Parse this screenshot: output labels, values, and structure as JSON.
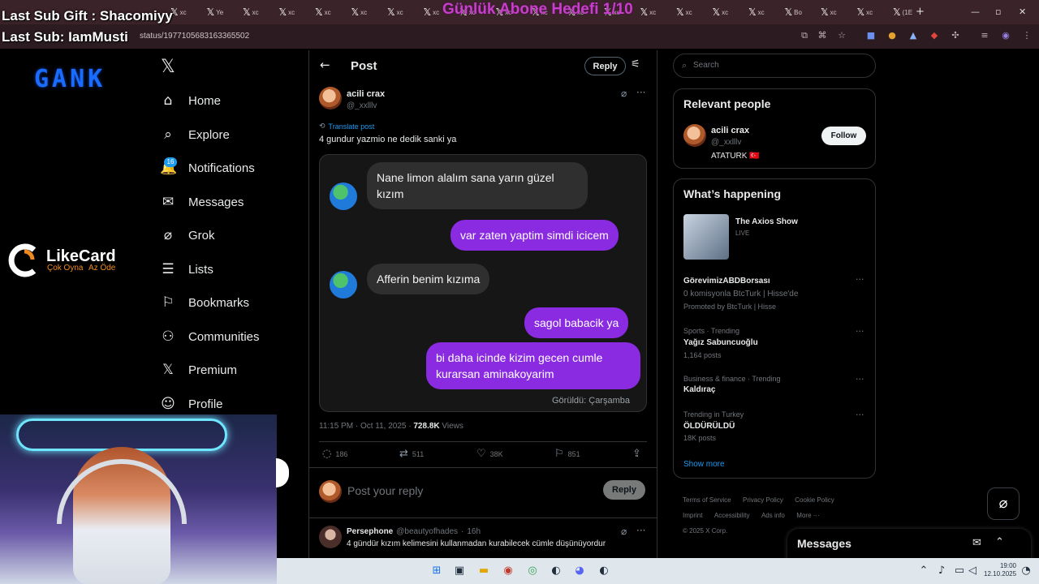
{
  "overlay": {
    "last_sub_gift": "Last Sub Gift : Shacomiyy",
    "last_sub": "Last Sub: IamMusti",
    "goal": "Günlük Abone Hedefi 1/10",
    "brand_logo": "GANK",
    "sponsor_name": "LikeCard",
    "sponsor_tag_left": "Çok Oyna",
    "sponsor_tag_right": "Az Öde"
  },
  "browser": {
    "url": "status/1977105683163365502",
    "tabs": [
      "xc",
      "Ye",
      "xc",
      "xc",
      "xc",
      "xc",
      "xc",
      "xc",
      "xc",
      "xc",
      "xc",
      "xc",
      "xc",
      "xc",
      "xc",
      "xc",
      "xc",
      "Bo",
      "xc",
      "xc",
      "(1E"
    ],
    "new_tab_icon": "plus-icon"
  },
  "sidebar": {
    "items": [
      {
        "label": "Home",
        "icon": "home-icon"
      },
      {
        "label": "Explore",
        "icon": "search-icon"
      },
      {
        "label": "Notifications",
        "icon": "bell-icon",
        "badge": "16"
      },
      {
        "label": "Messages",
        "icon": "envelope-icon"
      },
      {
        "label": "Grok",
        "icon": "grok-icon"
      },
      {
        "label": "Lists",
        "icon": "list-icon"
      },
      {
        "label": "Bookmarks",
        "icon": "bookmark-icon"
      },
      {
        "label": "Communities",
        "icon": "communities-icon"
      },
      {
        "label": "Premium",
        "icon": "x-logo-icon"
      },
      {
        "label": "Profile",
        "icon": "person-icon"
      }
    ]
  },
  "post": {
    "header_title": "Post",
    "reply_button": "Reply",
    "author_name": "acili crax",
    "author_handle": "@_xxlllv",
    "translate": "Translate post",
    "text": "4 gundur yazmio ne dedik sanki ya",
    "chat": {
      "m1": "Nane limon alalım sana yarın güzel kızım",
      "m2": "var zaten yaptim simdi icicem",
      "m3": "Afferin benim kızıma",
      "m4": "sagol babacik ya",
      "m5": "bi daha icinde kizim gecen cumle kurarsan aminakoyarim",
      "seen": "Görüldü: Çarşamba"
    },
    "time": "11:15 PM · Oct 11, 2025 ·",
    "views_count": "728.8K",
    "views_label": "Views",
    "stats": {
      "replies": "186",
      "reposts": "511",
      "likes": "38K",
      "bookmarks": "851"
    },
    "reply_placeholder": "Post your reply",
    "reply_submit": "Reply"
  },
  "reply1": {
    "name": "Persephone",
    "handle": "@beautyofhades",
    "time": "16h",
    "text": "4 gündür kızım kelimesini kullanmadan kurabilecek cümle düşünüyordur"
  },
  "right": {
    "search_placeholder": "Search",
    "relevant_title": "Relevant people",
    "person": {
      "name": "acili crax",
      "handle": "@_xxlllv",
      "bio": "ATATURK 🇹🇷",
      "follow": "Follow"
    },
    "happening_title": "What’s happening",
    "live": {
      "title": "The Axios Show",
      "status": "LIVE"
    },
    "promo": {
      "name": "GörevimizABDBorsası",
      "desc": "0 komisyonla BtcTurk | Hisse'de",
      "promoted": "Promoted by BtcTurk | Hisse"
    },
    "trends": [
      {
        "meta": "Sports · Trending",
        "name": "Yağız Sabuncuoğlu",
        "count": "1,164 posts"
      },
      {
        "meta": "Business & finance · Trending",
        "name": "Kaldıraç",
        "count": ""
      },
      {
        "meta": "Trending in Turkey",
        "name": "ÖLDÜRÜLDÜ",
        "count": "18K posts"
      }
    ],
    "show_more": "Show more",
    "footer": [
      "Terms of Service",
      "Privacy Policy",
      "Cookie Policy",
      "Imprint",
      "Accessibility",
      "Ads info",
      "More ···"
    ],
    "copyright": "© 2025 X Corp.",
    "messages_drawer": "Messages"
  },
  "taskbar": {
    "time": "19:00",
    "date": "12.10.2025"
  },
  "colors": {
    "accent": "#1d9bf0",
    "chat_out": "#8a2be2",
    "goal": "#c63ec9"
  }
}
